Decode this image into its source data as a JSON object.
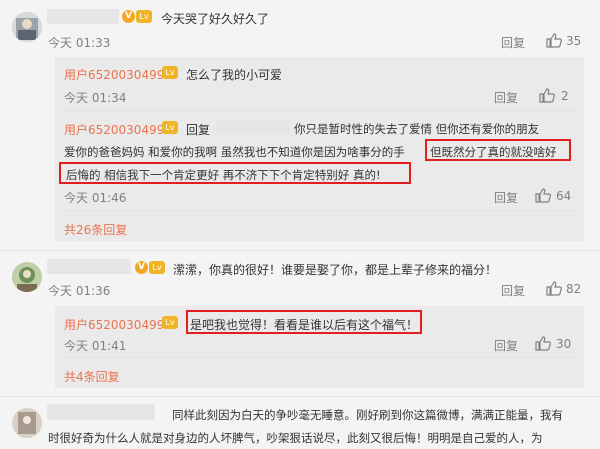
{
  "comments": [
    {
      "text": "今天哭了好久好久了",
      "time": "今天 01:33",
      "reply_label": "回复",
      "likes": "35",
      "replies": [
        {
          "user": "用户6520030499",
          "text": "怎么了我的小可爱",
          "time": "今天 01:34",
          "reply_label": "回复",
          "likes": "2"
        },
        {
          "user": "用户6520030499",
          "prefix": "回复",
          "line1": "你只是暂时性的失去了爱情 但你还有爱你的朋友",
          "line2a": "爱你的爸爸妈妈 和爱你的我啊 虽然我也不知道你是因为啥事分的手",
          "line2b": "但既然分了真的就没啥好",
          "line3": "后悔的 相信我下一个肯定更好 再不济下下个肯定特别好 真的!",
          "time": "今天 01:46",
          "reply_label": "回复",
          "likes": "64"
        }
      ],
      "more_replies": "共26条回复"
    },
    {
      "text": "潆潆，你真的很好！谁要是娶了你，都是上辈子修来的福分！",
      "time": "今天 01:36",
      "reply_label": "回复",
      "likes": "82",
      "replies": [
        {
          "user": "用户6520030499",
          "text": "是吧我也觉得！看看是谁以后有这个福气！",
          "time": "今天 01:41",
          "reply_label": "回复",
          "likes": "30"
        }
      ],
      "more_replies": "共4条回复"
    },
    {
      "line1": "同样此刻因为白天的争吵毫无睡意。刚好刷到你这篇微博，满满正能量，我有",
      "line2": "时很好奇为什么人就是对身边的人坏脾气，吵架狠话说尽，此刻又很后悔！明明是自己爱的人，为"
    }
  ],
  "icons": {
    "like": "thumbs-up-icon",
    "verified": "v-badge-icon",
    "level": "level-badge-icon"
  },
  "colors": {
    "username": "#eb7350",
    "highlight_box": "#e02020",
    "reply_bg": "#eaeaea"
  }
}
